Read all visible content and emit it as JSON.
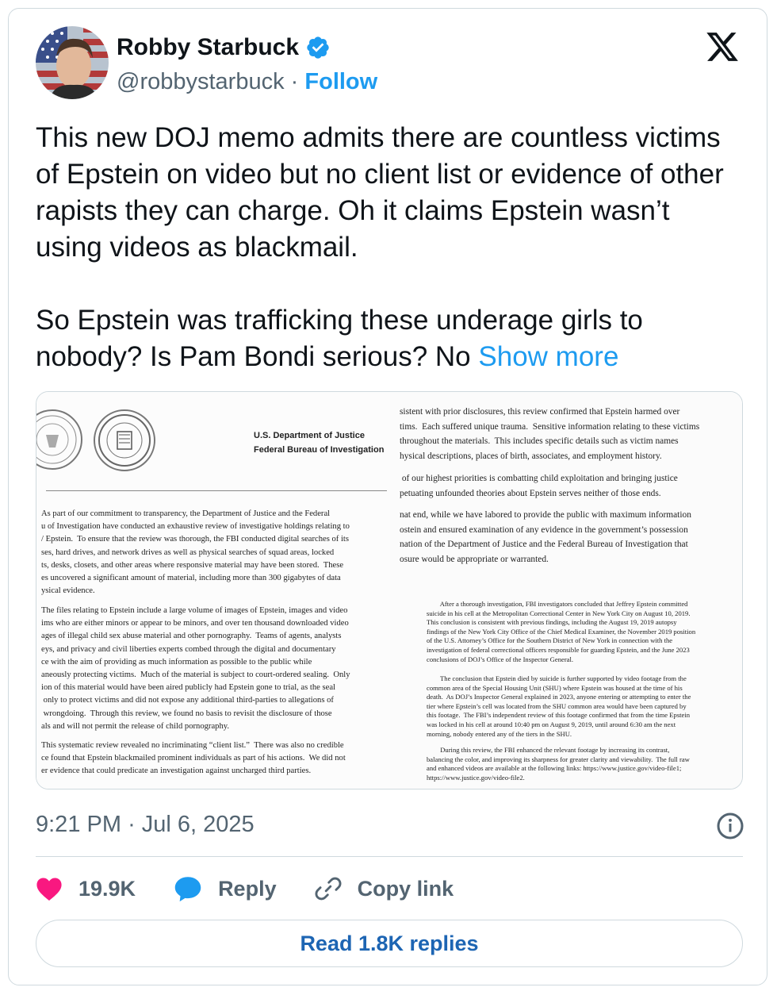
{
  "author": {
    "name": "Robby Starbuck",
    "handle": "@robbystarbuck",
    "separator": "·",
    "follow_label": "Follow"
  },
  "tweet": {
    "text": "This new DOJ memo admits there are countless victims of Epstein on video but no client list or evidence of other rapists they can charge. Oh it claims Epstein wasn’t using videos as blackmail.\n\nSo Epstein was trafficking these underage girls to nobody? Is Pam Bondi serious? No ",
    "show_more": "Show more"
  },
  "document": {
    "left": {
      "agency_line1": "U.S. Department of Justice",
      "agency_line2": "Federal Bureau of Investigation",
      "para1": "As part of our commitment to transparency, the Department of Justice and the Federal\nu of Investigation have conducted an exhaustive review of investigative holdings relating to\n/ Epstein.  To ensure that the review was thorough, the FBI conducted digital searches of its\nses, hard drives, and network drives as well as physical searches of squad areas, locked\nts, desks, closets, and other areas where responsive material may have been stored.  These\nes uncovered a significant amount of material, including more than 300 gigabytes of data\nysical evidence.",
      "para2": "The files relating to Epstein include a large volume of images of Epstein, images and video\nims who are either minors or appear to be minors, and over ten thousand downloaded video\nages of illegal child sex abuse material and other pornography.  Teams of agents, analysts\neys, and privacy and civil liberties experts combed through the digital and documentary\nce with the aim of providing as much information as possible to the public while\naneously protecting victims.  Much of the material is subject to court-ordered sealing.  Only\nion of this material would have been aired publicly had Epstein gone to trial, as the seal\n only to protect victims and did not expose any additional third-parties to allegations of\n wrongdoing.  Through this review, we found no basis to revisit the disclosure of those\nals and will not permit the release of child pornography.",
      "para3": "This systematic review revealed no incriminating “client list.”  There was also no credible\nce found that Epstein blackmailed prominent individuals as part of his actions.  We did not\ner evidence that could predicate an investigation against uncharged third parties."
    },
    "right": {
      "para1": "sistent with prior disclosures, this review confirmed that Epstein harmed over\ntims.  Each suffered unique trauma.  Sensitive information relating to these victims\nthroughout the materials.  This includes specific details such as victim names\nhysical descriptions, places of birth, associates, and employment history.",
      "para2": " of our highest priorities is combatting child exploitation and bringing justice\npetuating unfounded theories about Epstein serves neither of those ends.",
      "para3": "nat end, while we have labored to provide the public with maximum information\nostein and ensured examination of any evidence in the government’s possession\nnation of the Department of Justice and the Federal Bureau of Investigation that\nosure would be appropriate or warranted.",
      "small1": "        After a thorough investigation, FBI investigators concluded that Jeffrey Epstein committed\nsuicide in his cell at the Metropolitan Correctional Center in New York City on August 10, 2019.\nThis conclusion is consistent with previous findings, including the August 19, 2019 autopsy\nfindings of the New York City Office of the Chief Medical Examiner, the November 2019 position\nof the U.S. Attorney’s Office for the Southern District of New York in connection with the\ninvestigation of federal correctional officers responsible for guarding Epstein, and the June 2023\nconclusions of DOJ’s Office of the Inspector General.",
      "small2": "        The conclusion that Epstein died by suicide is further supported by video footage from the\ncommon area of the Special Housing Unit (SHU) where Epstein was housed at the time of his\ndeath.  As DOJ’s Inspector General explained in 2023, anyone entering or attempting to enter the\ntier where Epstein’s cell was located from the SHU common area would have been captured by\nthis footage.  The FBI’s independent review of this footage confirmed that from the time Epstein\nwas locked in his cell at around 10:40 pm on August 9, 2019, until around 6:30 am the next\nmorning, nobody entered any of the tiers in the SHU.",
      "small3": "        During this review, the FBI enhanced the relevant footage by increasing its contrast,\nbalancing the color, and improving its sharpness for greater clarity and viewability.  The full raw\nand enhanced videos are available at the following links: https://www.justice.gov/video-file1;\nhttps://www.justice.gov/video-file2."
    }
  },
  "meta": {
    "time": "9:21 PM",
    "separator": "·",
    "date": "Jul 6, 2025"
  },
  "actions": {
    "likes": "19.9K",
    "reply_label": "Reply",
    "copy_label": "Copy link",
    "read_replies": "Read 1.8K replies"
  },
  "colors": {
    "accent": "#1d9bf0",
    "like": "#f91880",
    "text": "#0f1419",
    "muted": "#536471",
    "border": "#cfd9de"
  },
  "icons": [
    "verified-badge-icon",
    "x-logo-icon",
    "info-icon",
    "heart-icon",
    "reply-bubble-icon",
    "link-icon"
  ]
}
